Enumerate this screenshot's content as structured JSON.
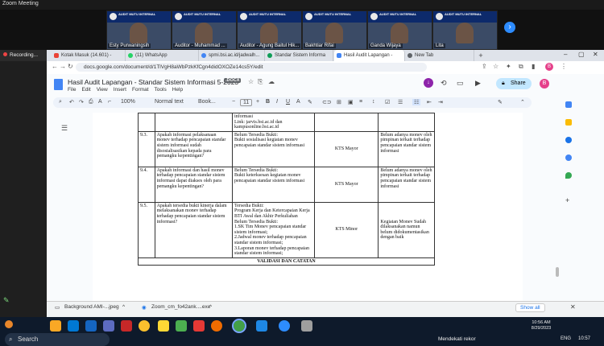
{
  "zoom": {
    "title": "Zoom Meeting",
    "participants": [
      {
        "name": "Esty Purwaningsih",
        "banner": "AUDIT MUTU INTERNAL"
      },
      {
        "name": "Auditor - Muhammad ...",
        "banner": "AUDIT MUTU INTERNAL"
      },
      {
        "name": "Auditor - Agung Baitul Hik...",
        "banner": "AUDIT MUTU INTERNAL"
      },
      {
        "name": "Bakhtiar Rifai",
        "banner": "AUDIT MUTU INTERNAL"
      },
      {
        "name": "Ganda Wijaya",
        "banner": "AUDIT MUTU INTERNAL"
      },
      {
        "name": "Lita",
        "banner": "AUDIT MUTU INTERNAL"
      }
    ],
    "recording_label": "Recording..."
  },
  "browser": {
    "tabs": [
      {
        "label": "Kotak Masuk (14.601) -",
        "color": "#ea4335"
      },
      {
        "label": "(11) WhatsApp",
        "color": "#25d366"
      },
      {
        "label": "spmi.bsi.ac.id/jadwalh...",
        "color": "#4285f4"
      },
      {
        "label": "Standar Sistem Informa",
        "color": "#0f9d58"
      },
      {
        "label": "Hasil Audit Lapangan -",
        "color": "#4285f4"
      },
      {
        "label": "New Tab",
        "color": "#5f6368"
      }
    ],
    "url": "docs.google.com/document/d/1TlVgH8aWbPzkKfCgn4didOXOZe14cs5Y/edit"
  },
  "doc": {
    "title": "Hasil Audit Lapangan - Standar Sistem Informasi 5-2023",
    "badge": ".DOCX",
    "menus": [
      "File",
      "Edit",
      "View",
      "Insert",
      "Format",
      "Tools",
      "Help"
    ],
    "share_label": "Share",
    "avatar_letter": "B",
    "toolbar": {
      "zoom": "100%",
      "style": "Normal text",
      "font": "Book...",
      "size": "11"
    }
  },
  "table": {
    "top_row_evidence": "informasi\nLink:    jarvis.bsi.ac.id    dan\nkampusonline.bsi.ac.id",
    "rows": [
      {
        "no": "9.3.",
        "question": "Apakah informasi pelaksanaan monev terhadap pencapaian standar sistem informasi sudah disosialisasikan kepada para pemangku kepentingan?",
        "evidence": "Belum Tersedia Bukti:\nBukti sosialisasi kegiatan monev pencapaian standar sistem informasi",
        "kts": "KTS Mayor",
        "recommendation": "Belum adanya monev oleh pimpinan terkait terhadap pencapaian standar sistem informasi"
      },
      {
        "no": "9.4.",
        "question": "Apakah informasi dan hasil monev terhadap pencapaian standar sistem informasi dapat diakses oleh para pemangku kepentingan?",
        "evidence": "Belum Tersedia Bukti:\nBukti keterksesan kegiatan monev pencapaian standar sistem informasi",
        "kts": "KTS Mayor",
        "recommendation": "Belum adanya monev oleh pimpinan terkait terhadap pencapaian standar sistem informasi"
      },
      {
        "no": "9.5.",
        "question": "Apakah tersedia bukti kinerja dalam melaksanakan monev terhadap terhadap pencapaian standar sistem informasi?",
        "evidence": "Tersedia Bukti:\nProgram Kerja dan Ketercapaian Kerja BTI Awal dan Akhir Perkuliahan\nBelum Tersedia Bukti:\n1.SK Tim Monev pencapaian standar sistem informasi;\n2.Jadwal monev terhadap pencapaian standar sistem informasi;\n3.Laporan monev terhadap pencapaian standar sistem informasi;",
        "kts": "KTS Minor",
        "recommendation": "Kegiatan Monev Sudah dilaksanakan namun belum didokumentasikan dengan baik"
      }
    ],
    "footer": "VALIDASI DAN CATATAN"
  },
  "downloads": [
    {
      "label": "Background AMI-...jpeg"
    },
    {
      "label": "Zoom_cm_fo42ank....exe"
    }
  ],
  "downloads_show_all": "Show all",
  "taskbar": {
    "search_label": "Search",
    "notification": "Mendekati rekor",
    "time": "10:56 AM",
    "date": "8/29/2023",
    "lang": "ENG",
    "time2": "10:57"
  }
}
